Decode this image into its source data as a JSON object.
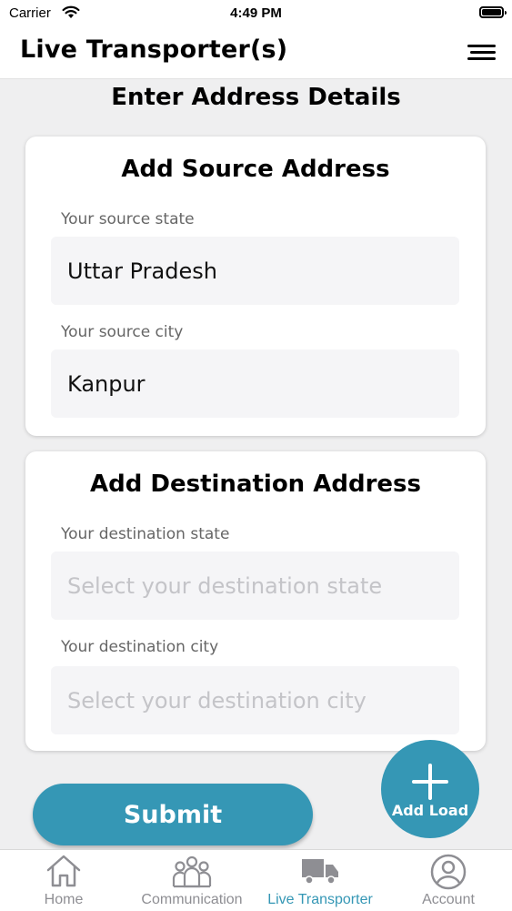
{
  "status_bar": {
    "carrier": "Carrier",
    "time": "4:49 PM"
  },
  "header": {
    "title": "Live Transporter(s)"
  },
  "page": {
    "title": "Enter Address Details"
  },
  "source": {
    "title": "Add Source Address",
    "state_label": "Your source state",
    "state_value": "Uttar Pradesh",
    "city_label": "Your source city",
    "city_value": "Kanpur"
  },
  "destination": {
    "title": "Add Destination Address",
    "state_label": "Your destination state",
    "state_placeholder": "Select your destination state",
    "city_label": "Your destination city",
    "city_placeholder": "Select your destination city"
  },
  "actions": {
    "submit_label": "Submit",
    "add_load_label": "Add Load"
  },
  "tabs": [
    {
      "label": "Home",
      "icon": "home-icon"
    },
    {
      "label": "Communication",
      "icon": "people-icon"
    },
    {
      "label": "Live Transporter",
      "icon": "truck-icon",
      "active": true
    },
    {
      "label": "Account",
      "icon": "account-icon"
    }
  ],
  "colors": {
    "accent": "#3597b5",
    "tab_inactive": "#8e8e93"
  }
}
